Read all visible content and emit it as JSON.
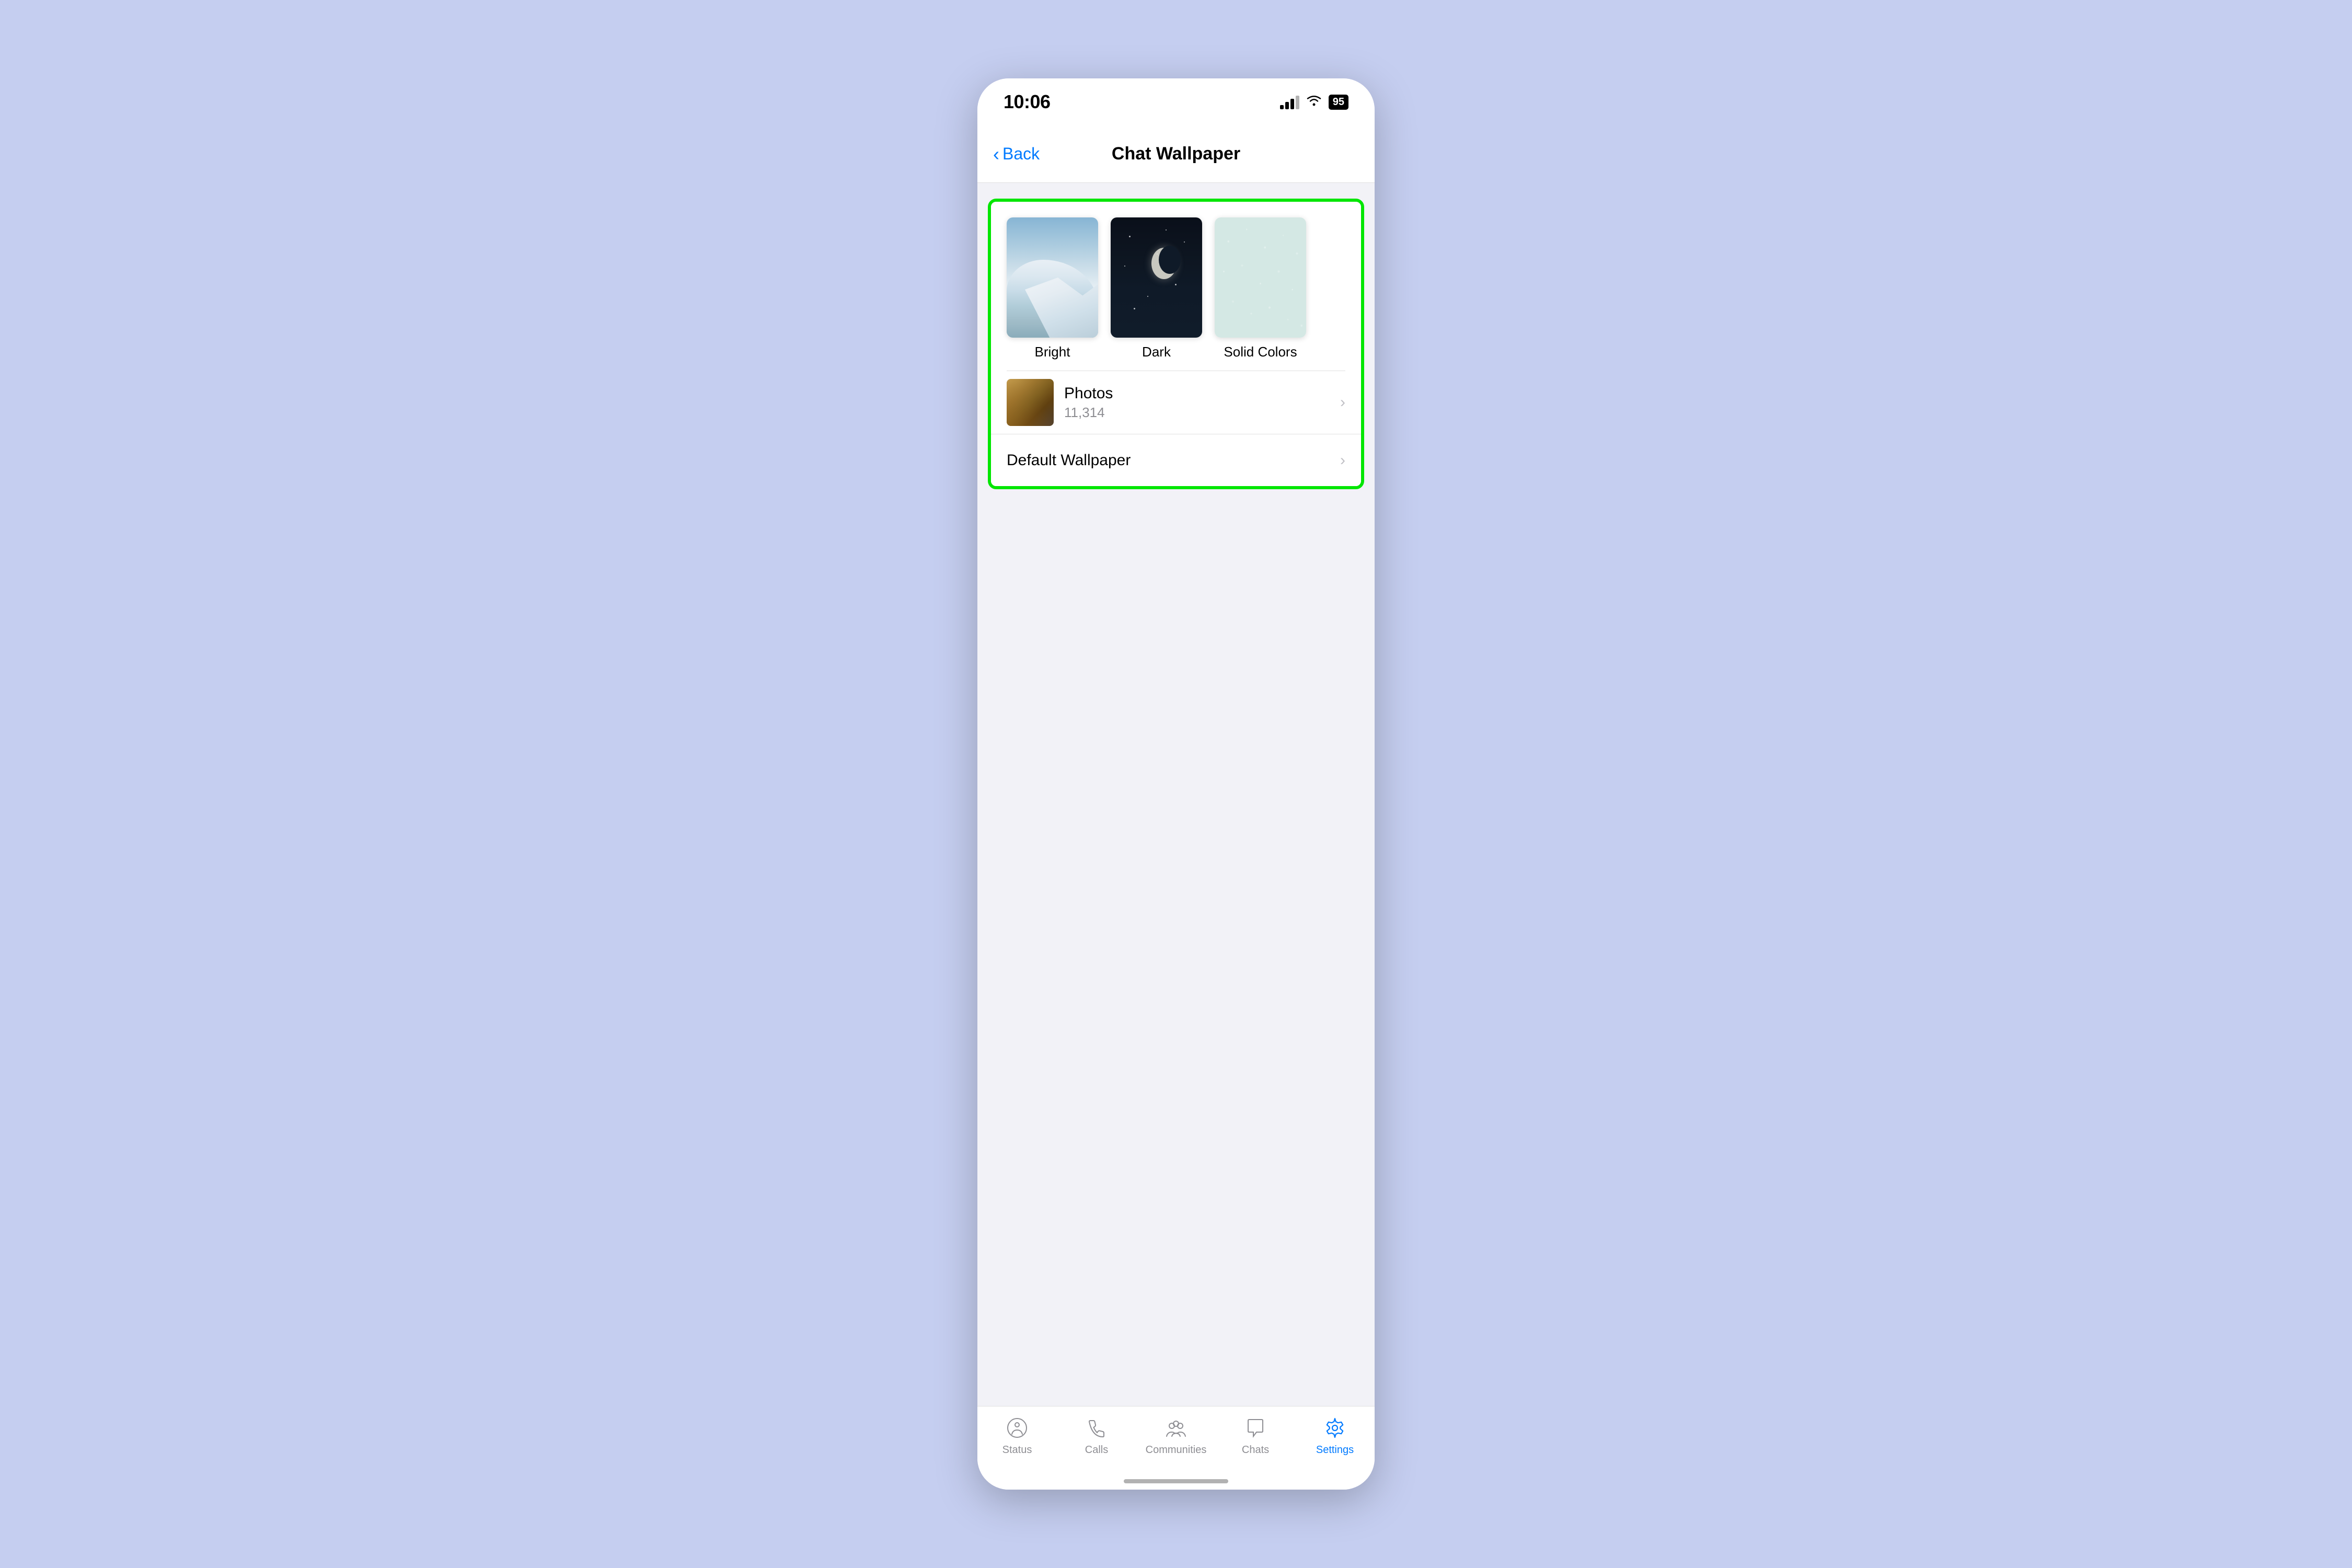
{
  "background": "#c5cef0",
  "statusBar": {
    "time": "10:06",
    "battery": "95"
  },
  "navBar": {
    "backLabel": "Back",
    "title": "Chat Wallpaper"
  },
  "wallpaperOptions": [
    {
      "id": "bright",
      "label": "Bright"
    },
    {
      "id": "dark",
      "label": "Dark"
    },
    {
      "id": "solid",
      "label": "Solid Colors"
    }
  ],
  "photosRow": {
    "title": "Photos",
    "count": "11,314"
  },
  "defaultWallpaper": {
    "label": "Default Wallpaper"
  },
  "tabBar": {
    "items": [
      {
        "id": "status",
        "label": "Status",
        "active": false
      },
      {
        "id": "calls",
        "label": "Calls",
        "active": false
      },
      {
        "id": "communities",
        "label": "Communities",
        "active": false
      },
      {
        "id": "chats",
        "label": "Chats",
        "active": false
      },
      {
        "id": "settings",
        "label": "Settings",
        "active": true
      }
    ]
  }
}
